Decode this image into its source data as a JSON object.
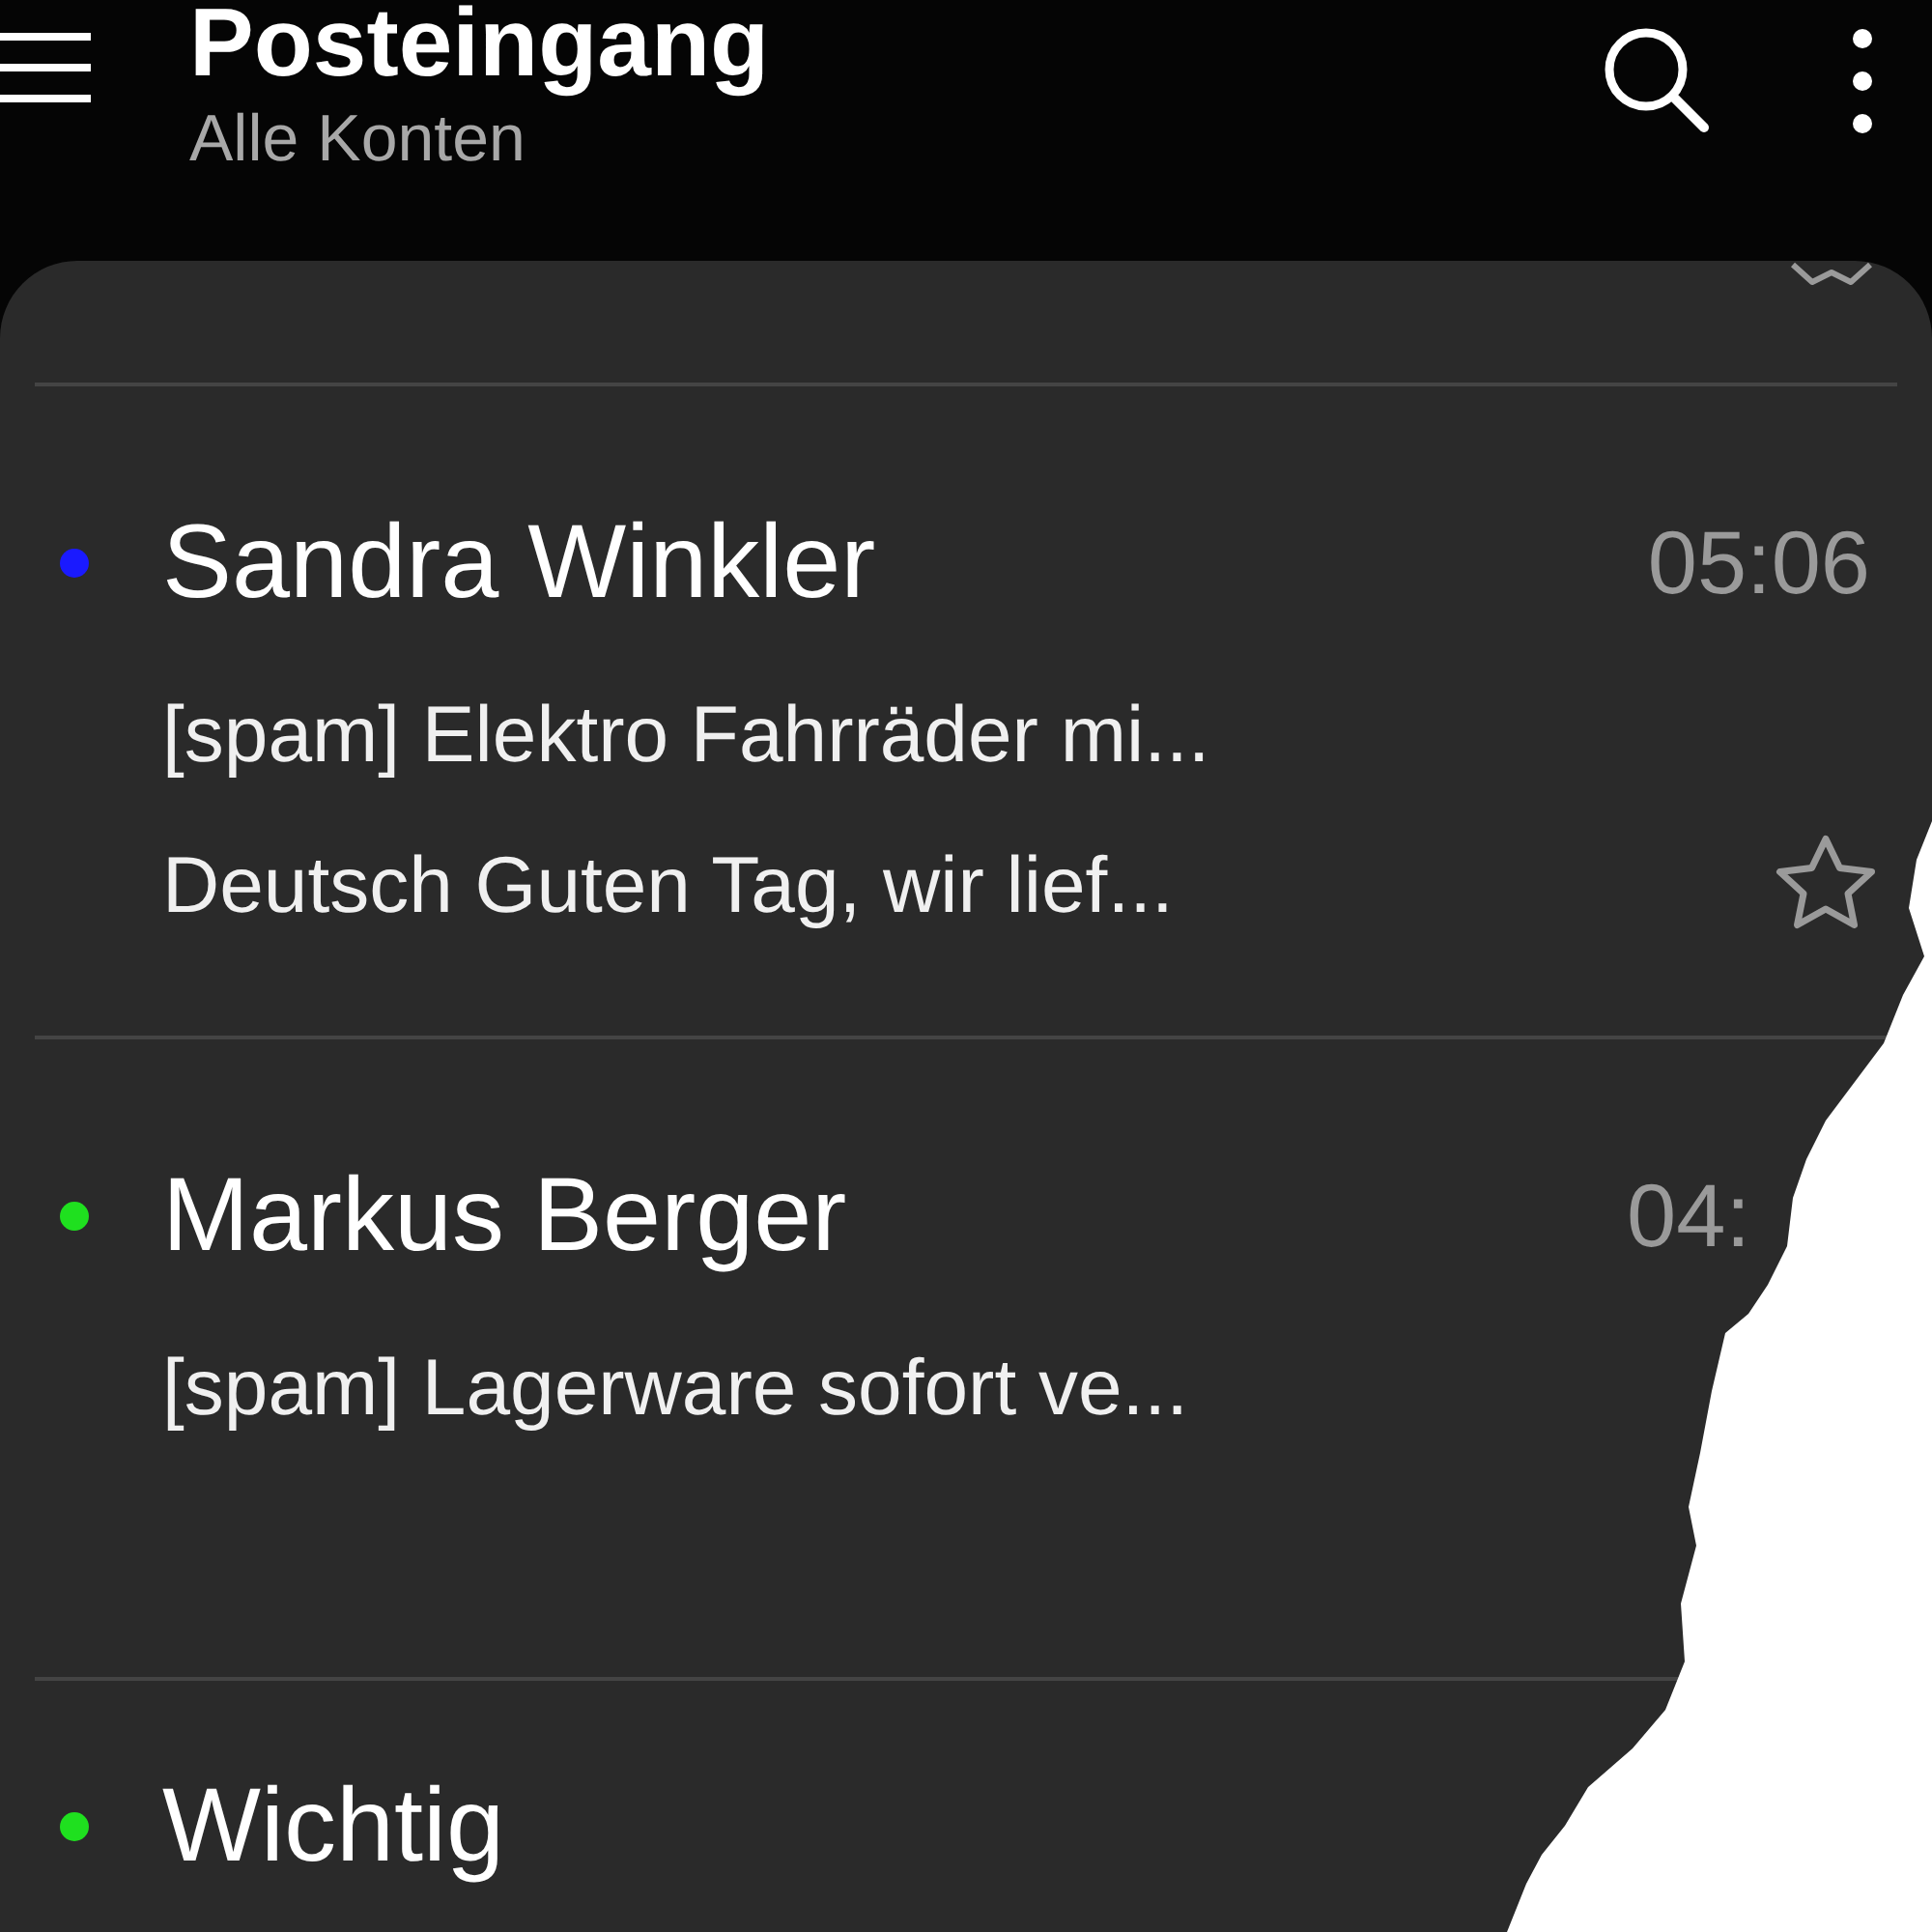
{
  "header": {
    "title": "Posteingang",
    "subtitle": "Alle Konten"
  },
  "messages": [
    {
      "sender": "Sandra Winkler",
      "time": "05:06",
      "subject": "[spam] Elektro Fahrräder mi...",
      "preview": "Deutsch  Guten Tag,  wir lief...",
      "color": "#1a1aff",
      "starred": false
    },
    {
      "sender": "Markus Berger",
      "time": "04:",
      "subject": "[spam]  Lagerware sofort ve...",
      "color": "#1fe01f"
    },
    {
      "sender": "Wichtig",
      "color": "#1fe01f"
    }
  ]
}
